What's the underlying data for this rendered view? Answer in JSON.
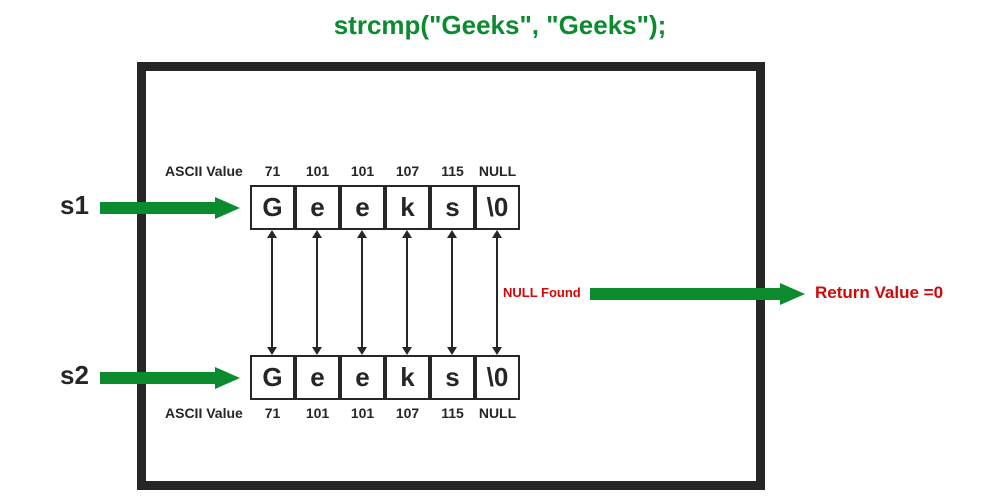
{
  "title": "strcmp(\"Geeks\", \"Geeks\");",
  "ascii_label": "ASCII Value",
  "s1": {
    "name": "s1",
    "chars": [
      "G",
      "e",
      "e",
      "k",
      "s",
      "\\0"
    ],
    "ascii": [
      "71",
      "101",
      "101",
      "107",
      "115",
      "NULL"
    ]
  },
  "s2": {
    "name": "s2",
    "chars": [
      "G",
      "e",
      "e",
      "k",
      "s",
      "\\0"
    ],
    "ascii": [
      "71",
      "101",
      "101",
      "107",
      "115",
      "NULL"
    ]
  },
  "null_found": "NULL Found",
  "return_value": "Return Value =0",
  "colors": {
    "green": "#0b8a2e",
    "red": "#d20707",
    "black": "#262626"
  }
}
